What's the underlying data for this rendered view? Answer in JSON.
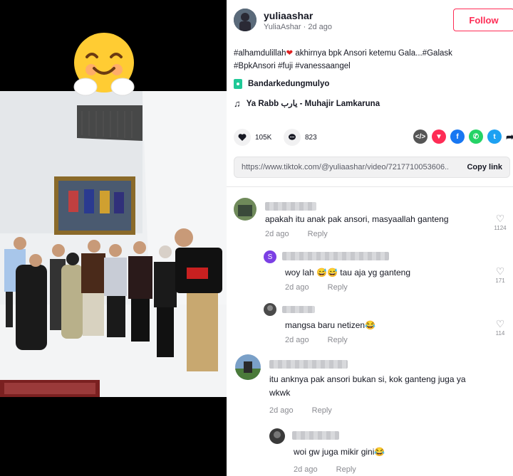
{
  "post": {
    "author_name": "yuliaashar",
    "author_handle": "YuliaAshar",
    "posted_ago": "2d ago",
    "follow_label": "Follow",
    "caption_line1_a": "#alhamdulillah",
    "caption_line1_b": " akhirnya bpk Ansori ketemu Gala...#Galask",
    "caption_line2": "#BpkAnsori #fuji #vanessaangel",
    "location": "Bandarkedungmulyo",
    "music": "Ya Rabb يارب - Muhajir Lamkaruna",
    "likes": "105K",
    "comments_count": "823",
    "link_url": "https://www.tiktok.com/@yuliaashar/video/7217710053606...",
    "copy_link_label": "Copy link",
    "separator": "·"
  },
  "comments": [
    {
      "text": "apakah itu anak pak ansori, masyaallah ganteng",
      "time": "2d ago",
      "reply": "Reply",
      "likes": "1124"
    },
    {
      "text": "woy lah 😅😅 tau aja yg ganteng",
      "time": "2d ago",
      "reply": "Reply",
      "likes": "171"
    },
    {
      "text": "mangsa baru netizen😂",
      "time": "2d ago",
      "reply": "Reply",
      "likes": "114"
    },
    {
      "text": "itu anknya pak ansori bukan si, kok ganteng juga ya",
      "text2": "wkwk",
      "time": "2d ago",
      "reply": "Reply"
    },
    {
      "text": "woi gw juga mikir gini😂",
      "time": "2d ago",
      "reply": "Reply"
    }
  ],
  "colors": {
    "accent": "#fe2c55",
    "share_embed": "#555555",
    "share_send": "#fe2c55",
    "share_facebook": "#1877f2",
    "share_whatsapp": "#25d366",
    "share_twitter": "#1da1f2"
  },
  "icons": {
    "like": "heart-icon",
    "comment": "comment-icon",
    "location": "location-pin-icon",
    "music": "music-note-icon",
    "share": [
      "embed-icon",
      "send-icon",
      "facebook-icon",
      "whatsapp-icon",
      "twitter-icon",
      "share-arrow-icon"
    ]
  }
}
